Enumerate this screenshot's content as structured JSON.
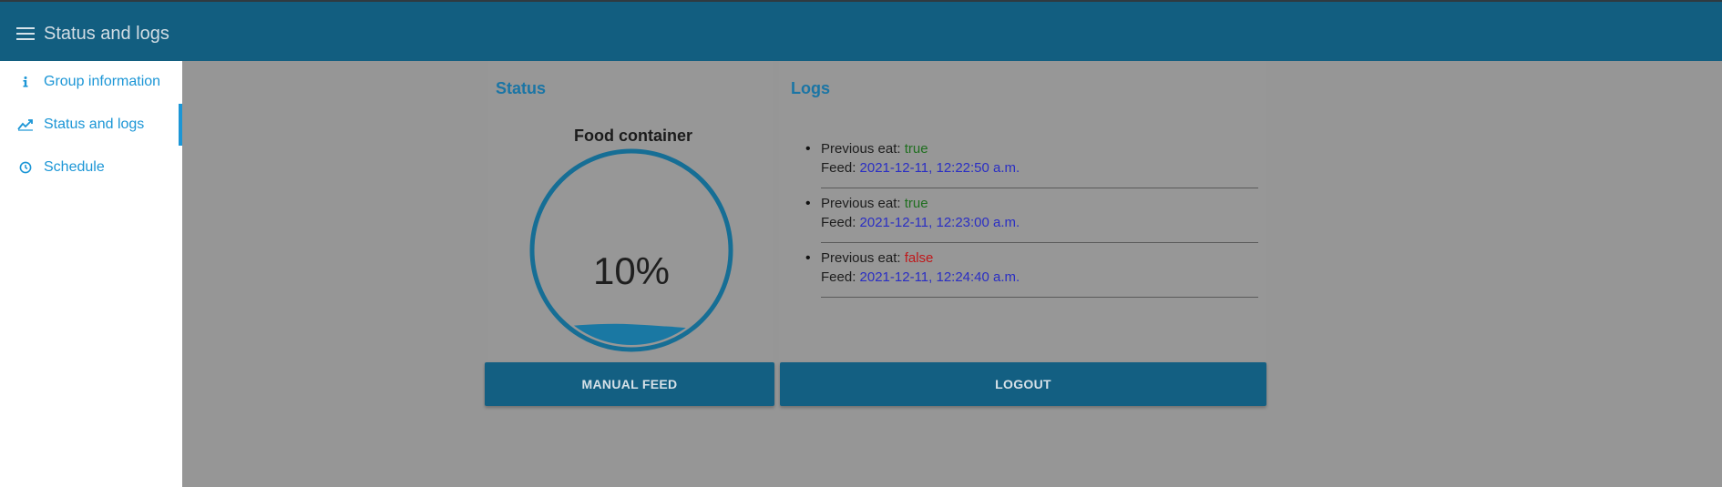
{
  "header": {
    "title": "Status and logs"
  },
  "sidebar": {
    "items": [
      {
        "label": "Group information",
        "icon": "info-icon"
      },
      {
        "label": "Status and logs",
        "icon": "chart-line-icon",
        "active": true
      },
      {
        "label": "Schedule",
        "icon": "clock-icon"
      }
    ]
  },
  "status": {
    "title": "Status",
    "container_label": "Food container",
    "fill_text": "10%",
    "fill_fraction": 0.1
  },
  "logs": {
    "title": "Logs",
    "entries": [
      {
        "prev_label": "Previous eat: ",
        "prev_value": "true",
        "feed_label": "Feed: ",
        "feed_value": "2021-12-11, 12:22:50 a.m."
      },
      {
        "prev_label": "Previous eat: ",
        "prev_value": "true",
        "feed_label": "Feed: ",
        "feed_value": "2021-12-11, 12:23:00 a.m."
      },
      {
        "prev_label": "Previous eat: ",
        "prev_value": "false",
        "feed_label": "Feed: ",
        "feed_value": "2021-12-11, 12:24:40 a.m."
      }
    ]
  },
  "buttons": {
    "manual_feed": "MANUAL FEED",
    "logout": "LOGOUT"
  },
  "colors": {
    "primary": "#125e80",
    "accent": "#1c96d6",
    "true": "#1f6f1f",
    "false": "#c0181b",
    "date": "#2a2ec4"
  }
}
